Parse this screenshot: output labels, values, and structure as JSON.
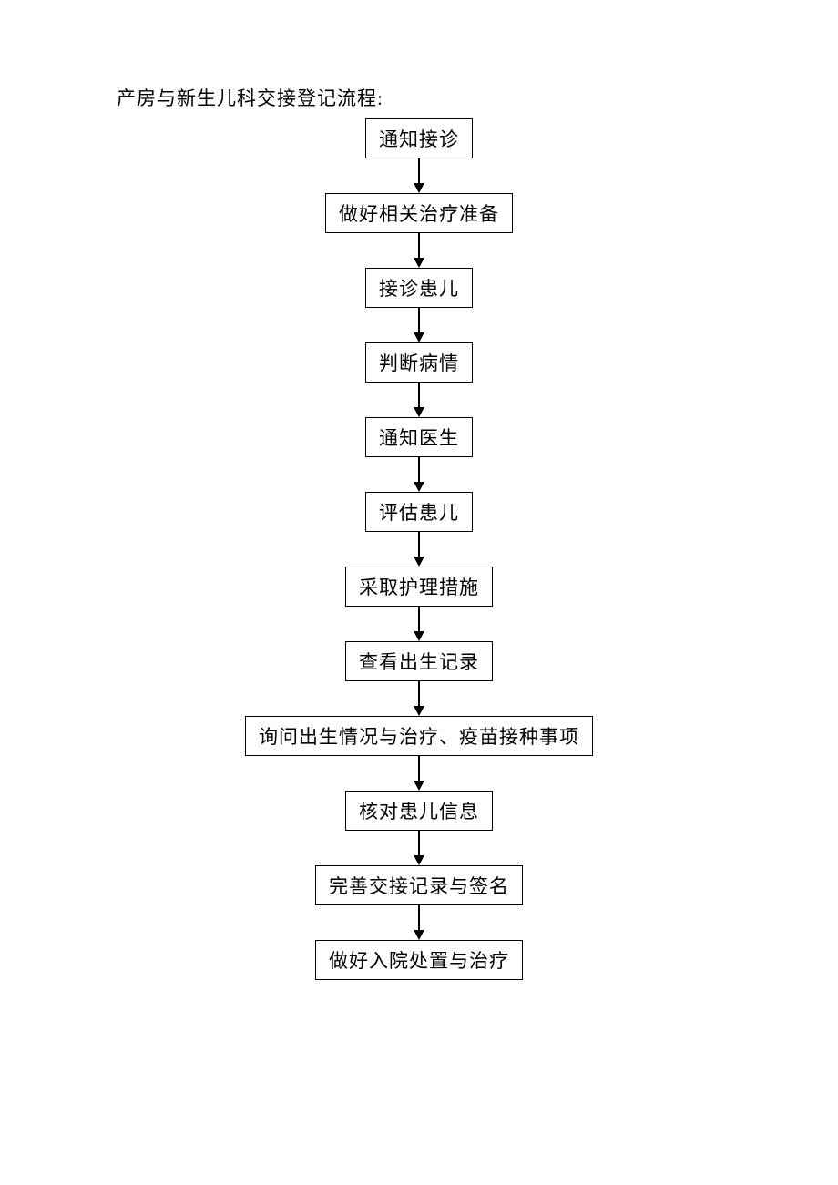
{
  "title": "产房与新生儿科交接登记流程:",
  "flow": {
    "steps": [
      "通知接诊",
      "做好相关治疗准备",
      "接诊患儿",
      "判断病情",
      "通知医生",
      "评估患儿",
      "采取护理措施",
      "查看出生记录",
      "询问出生情况与治疗、疫苗接种事项",
      "核对患儿信息",
      "完善交接记录与签名",
      "做好入院处置与治疗"
    ]
  }
}
